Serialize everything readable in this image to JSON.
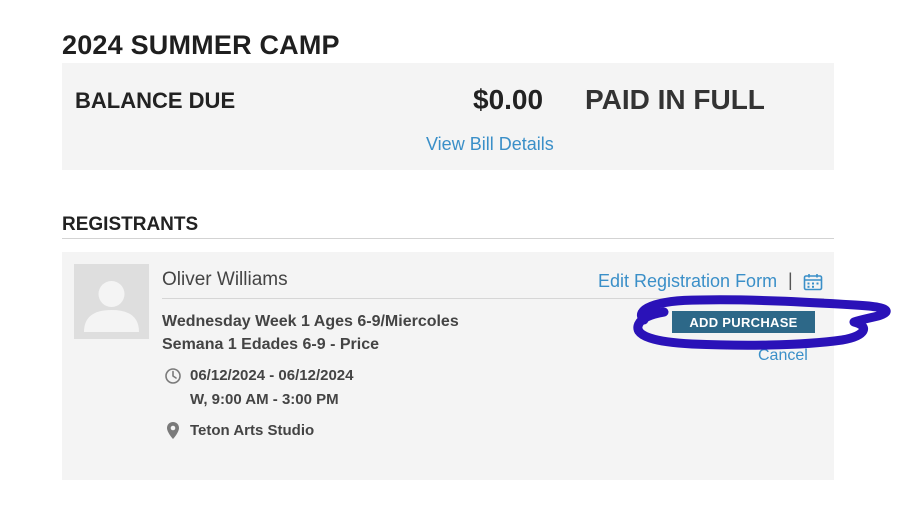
{
  "page": {
    "title": "2024 SUMMER CAMP"
  },
  "balance": {
    "label": "BALANCE DUE",
    "amount": "$0.00",
    "status": "PAID IN FULL",
    "view_bill_link": "View Bill Details"
  },
  "registrants": {
    "heading": "REGISTRANTS",
    "items": [
      {
        "name": "Oliver Williams",
        "edit_form_link": "Edit Registration Form",
        "divider": "|",
        "calendar_icon": "calendar-icon",
        "program_line1": "Wednesday Week 1 Ages 6-9/Miercoles",
        "program_line2": "Semana 1 Edades 6-9 - Price",
        "add_purchase_label": "ADD PURCHASE",
        "cancel_label": "Cancel",
        "date_range": "06/12/2024 - 06/12/2024",
        "schedule": "W, 9:00 AM - 3:00 PM",
        "location": "Teton Arts Studio",
        "clock_icon": "clock-icon",
        "location_icon": "map-pin-icon",
        "avatar_icon": "user-placeholder-icon"
      }
    ]
  },
  "annotation": {
    "color": "#2a12b8"
  },
  "colors": {
    "link": "#3a8fc8",
    "button_bg": "#2d6888",
    "panel_bg": "#f4f4f4"
  }
}
